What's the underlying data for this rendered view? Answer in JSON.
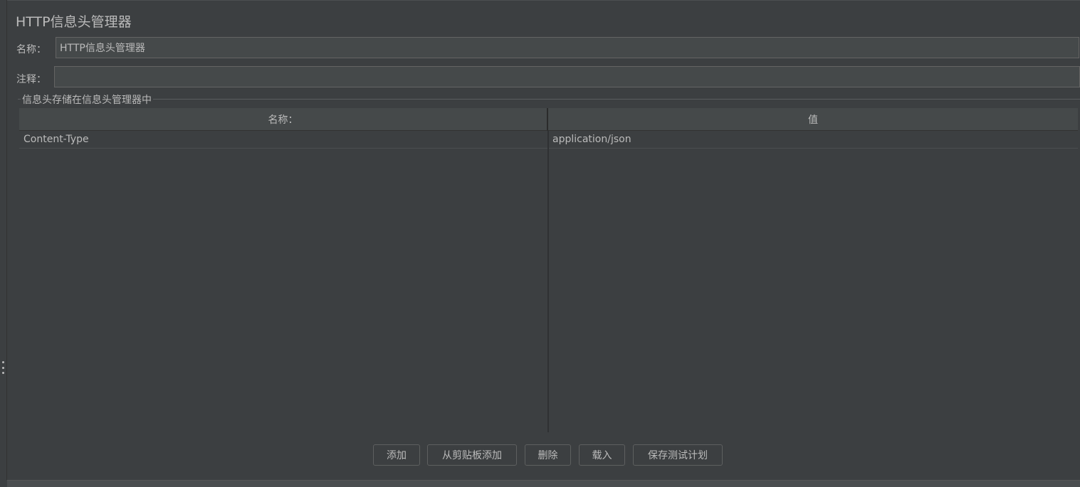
{
  "panel": {
    "title": "HTTP信息头管理器"
  },
  "fields": {
    "name_label": "名称：",
    "name_value": "HTTP信息头管理器",
    "comment_label": "注释：",
    "comment_value": ""
  },
  "group": {
    "title": "信息头存储在信息头管理器中"
  },
  "table": {
    "columns": [
      "名称：",
      "值"
    ],
    "rows": [
      [
        "Content-Type",
        "application/json"
      ]
    ]
  },
  "buttons": {
    "add": "添加",
    "add_from_clipboard": "从剪贴板添加",
    "delete": "删除",
    "load": "载入",
    "save_test_plan": "保存测试计划"
  }
}
